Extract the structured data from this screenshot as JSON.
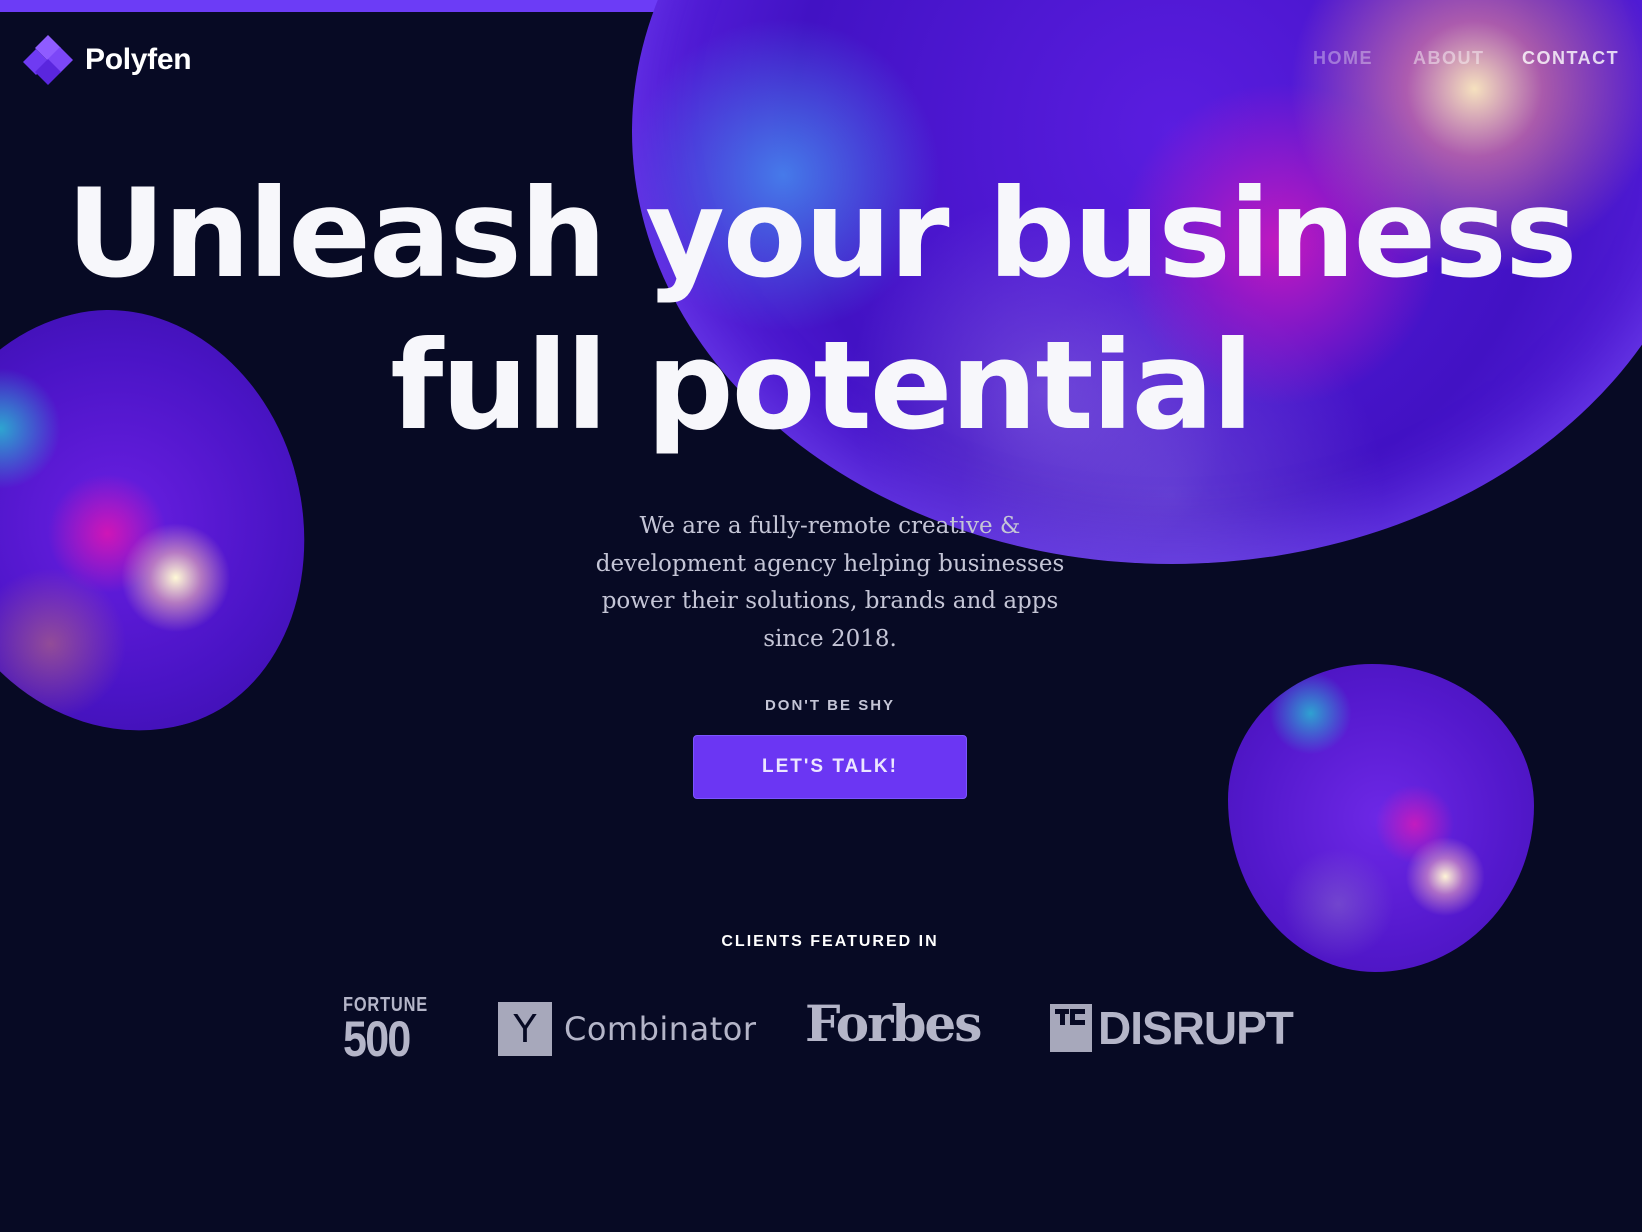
{
  "brand": {
    "name": "Polyfen",
    "accent_color": "#6c3cf6",
    "background_color": "#070a24"
  },
  "nav": {
    "items": [
      {
        "label": "HOME"
      },
      {
        "label": "ABOUT"
      },
      {
        "label": "CONTACT"
      }
    ]
  },
  "hero": {
    "title_line1": "Unleash your business",
    "title_line2": "full potential",
    "description": "We are a fully-remote creative & development agency helping businesses power their solutions, brands and apps since 2018."
  },
  "cta": {
    "kicker": "DON'T BE SHY",
    "button_label": "LET'S TALK!"
  },
  "clients": {
    "heading": "CLIENTS FEATURED IN",
    "logos": [
      {
        "name": "Fortune 500",
        "line1": "FORTUNE",
        "line2": "500",
        "icon": "fortune-500-logo"
      },
      {
        "name": "Y Combinator",
        "mark": "Y",
        "text": "Combinator",
        "icon": "y-combinator-logo"
      },
      {
        "name": "Forbes",
        "text": "Forbes",
        "icon": "forbes-logo"
      },
      {
        "name": "TC Disrupt",
        "mark": "TC",
        "text": "DISRUPT",
        "icon": "techcrunch-disrupt-logo"
      }
    ]
  }
}
